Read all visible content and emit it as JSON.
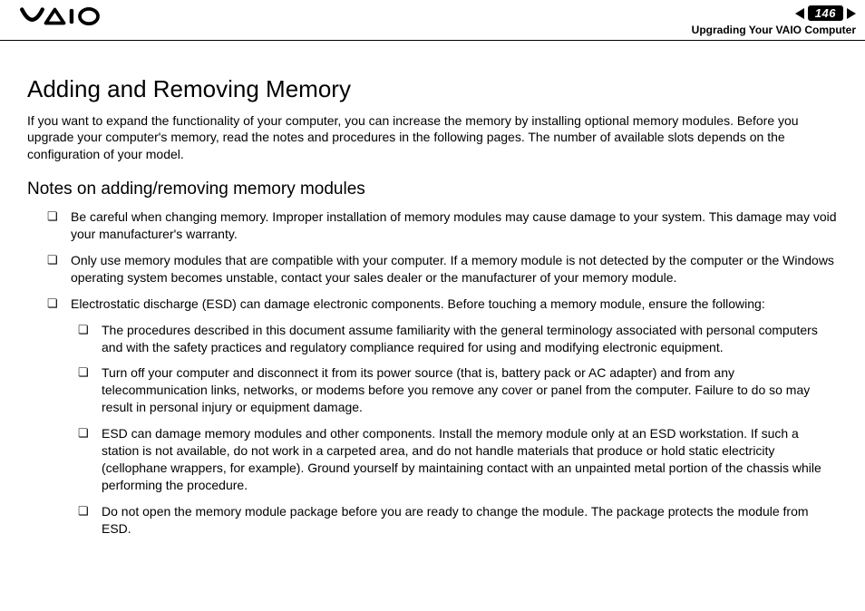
{
  "header": {
    "page_number": "146",
    "section_label": "Upgrading Your VAIO Computer"
  },
  "main": {
    "title": "Adding and Removing Memory",
    "intro": "If you want to expand the functionality of your computer, you can increase the memory by installing optional memory modules. Before you upgrade your computer's memory, read the notes and procedures in the following pages. The number of available slots depends on the configuration of your model.",
    "subtitle": "Notes on adding/removing memory modules",
    "notes": [
      "Be careful when changing memory. Improper installation of memory modules may cause damage to your system. This damage may void your manufacturer's warranty.",
      "Only use memory modules that are compatible with your computer. If a memory module is not detected by the computer or the Windows operating system becomes unstable, contact your sales dealer or the manufacturer of your memory module.",
      "Electrostatic discharge (ESD) can damage electronic components. Before touching a memory module, ensure the following:"
    ],
    "sub_notes": [
      "The procedures described in this document assume familiarity with the general terminology associated with personal computers and with the safety practices and regulatory compliance required for using and modifying electronic equipment.",
      "Turn off your computer and disconnect it from its power source (that is, battery pack or AC adapter) and from any telecommunication links, networks, or modems before you remove any cover or panel from the computer. Failure to do so may result in personal injury or equipment damage.",
      "ESD can damage memory modules and other components. Install the memory module only at an ESD workstation. If such a station is not available, do not work in a carpeted area, and do not handle materials that produce or hold static electricity (cellophane wrappers, for example). Ground yourself by maintaining contact with an unpainted metal portion of the chassis while performing the procedure.",
      "Do not open the memory module package before you are ready to change the module. The package protects the module from ESD."
    ]
  }
}
